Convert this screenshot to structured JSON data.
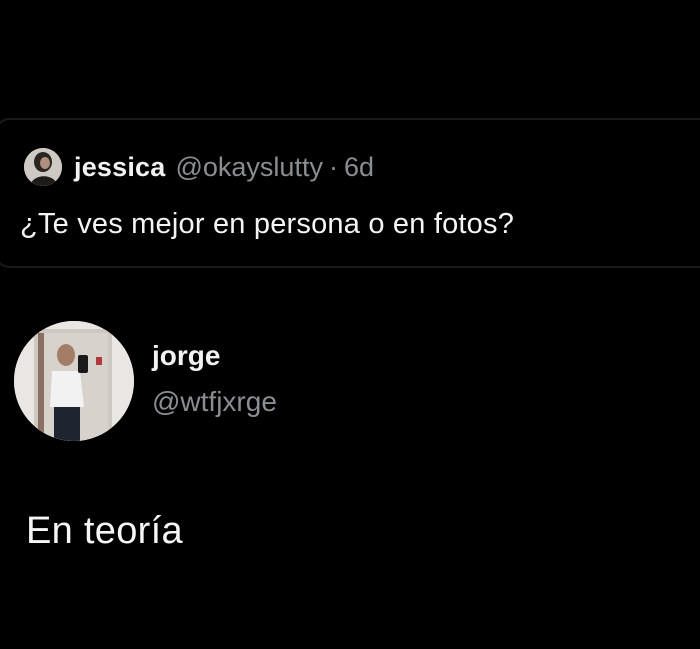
{
  "quoted_tweet": {
    "author_name": "jessica",
    "author_handle": "@okayslutty",
    "separator": "·",
    "time": "6d",
    "text": "¿Te ves mejor en persona o en fotos?",
    "avatar_icon": "user-photo-avatar-icon"
  },
  "reply": {
    "author_name": "jorge",
    "author_handle": "@wtfjxrge",
    "avatar_icon": "mirror-selfie-avatar-icon",
    "text": "En teoría"
  },
  "colors": {
    "background": "#000000",
    "primary_text": "#f2f2f2",
    "secondary_text": "#8a8d91",
    "card_border": "#1a1a1a"
  }
}
